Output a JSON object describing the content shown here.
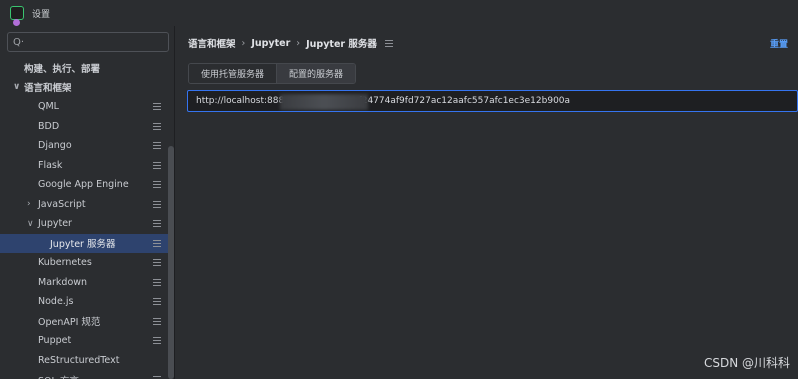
{
  "window": {
    "title": "设置",
    "logo_icon": "app-logo-icon"
  },
  "search": {
    "icon": "search-icon",
    "glyph": "Q·",
    "value": ""
  },
  "sidebar": {
    "items": [
      {
        "label": "构建、执行、部署",
        "level": 0,
        "bold": true,
        "chevron": "",
        "badge": false,
        "selected": false
      },
      {
        "label": "语言和框架",
        "level": 0,
        "bold": true,
        "chevron": "∨",
        "badge": false,
        "selected": false
      },
      {
        "label": "QML",
        "level": 1,
        "bold": false,
        "chevron": "",
        "badge": true,
        "selected": false
      },
      {
        "label": "BDD",
        "level": 1,
        "bold": false,
        "chevron": "",
        "badge": true,
        "selected": false
      },
      {
        "label": "Django",
        "level": 1,
        "bold": false,
        "chevron": "",
        "badge": true,
        "selected": false
      },
      {
        "label": "Flask",
        "level": 1,
        "bold": false,
        "chevron": "",
        "badge": true,
        "selected": false
      },
      {
        "label": "Google App Engine",
        "level": 1,
        "bold": false,
        "chevron": "",
        "badge": true,
        "selected": false
      },
      {
        "label": "JavaScript",
        "level": 1,
        "bold": false,
        "chevron": "›",
        "badge": true,
        "selected": false
      },
      {
        "label": "Jupyter",
        "level": 1,
        "bold": false,
        "chevron": "∨",
        "badge": true,
        "selected": false
      },
      {
        "label": "Jupyter 服务器",
        "level": 2,
        "bold": false,
        "chevron": "",
        "badge": true,
        "selected": true
      },
      {
        "label": "Kubernetes",
        "level": 1,
        "bold": false,
        "chevron": "",
        "badge": true,
        "selected": false
      },
      {
        "label": "Markdown",
        "level": 1,
        "bold": false,
        "chevron": "",
        "badge": true,
        "selected": false
      },
      {
        "label": "Node.js",
        "level": 1,
        "bold": false,
        "chevron": "",
        "badge": true,
        "selected": false
      },
      {
        "label": "OpenAPI 规范",
        "level": 1,
        "bold": false,
        "chevron": "",
        "badge": true,
        "selected": false
      },
      {
        "label": "Puppet",
        "level": 1,
        "bold": false,
        "chevron": "",
        "badge": true,
        "selected": false
      },
      {
        "label": "ReStructuredText",
        "level": 1,
        "bold": false,
        "chevron": "",
        "badge": false,
        "selected": false
      },
      {
        "label": "SQL 方言",
        "level": 1,
        "bold": false,
        "chevron": "",
        "badge": true,
        "selected": false
      }
    ]
  },
  "breadcrumb": {
    "items": [
      "语言和框架",
      "Jupyter",
      "Jupyter 服务器"
    ],
    "separator": "›"
  },
  "reset_label": "重置",
  "tabs": [
    {
      "label": "使用托管服务器",
      "active": false
    },
    {
      "label": "配置的服务器",
      "active": true
    }
  ],
  "server_url": {
    "value": "http://localhost:888                          f24774af9fd727ac12aafc557afc1ec3e12b900a"
  },
  "watermark": "CSDN @川科科",
  "colors": {
    "accent": "#3574f0",
    "selection": "#2e436e",
    "link": "#589df6"
  }
}
